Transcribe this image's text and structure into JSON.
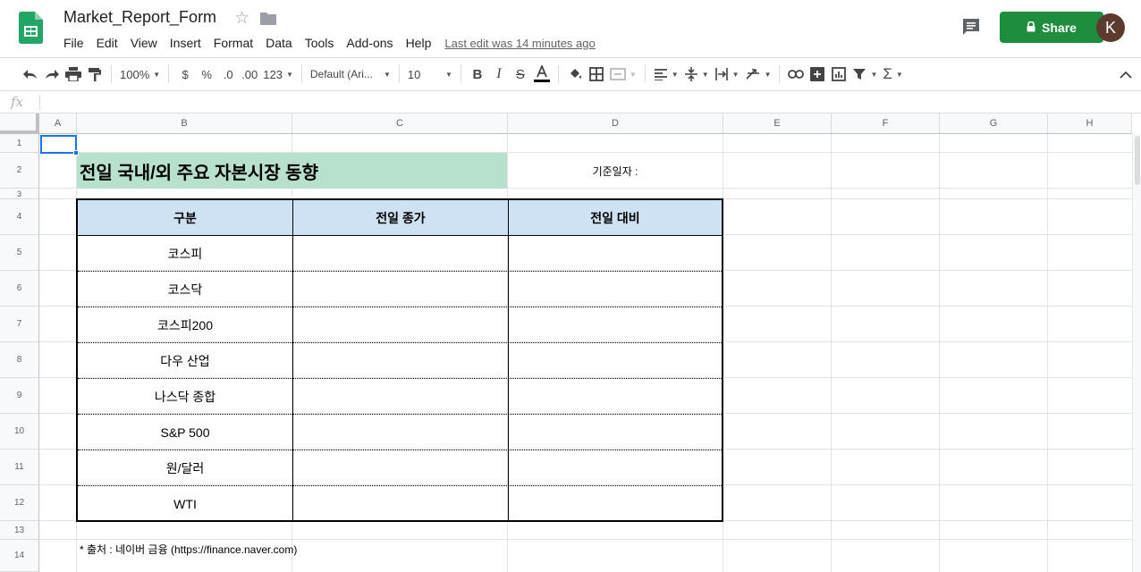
{
  "app": {
    "doc_title": "Market_Report_Form",
    "last_edit": "Last edit was 14 minutes ago",
    "share_label": "Share",
    "avatar_letter": "K"
  },
  "menu": [
    "File",
    "Edit",
    "View",
    "Insert",
    "Format",
    "Data",
    "Tools",
    "Add-ons",
    "Help"
  ],
  "toolbar": {
    "zoom": "100%",
    "currency": "$",
    "percent": "%",
    "decrease_decimal": ".0",
    "increase_decimal": ".00",
    "more_formats": "123",
    "font": "Default (Ari...",
    "font_size": "10"
  },
  "formula_bar": {
    "fx": "fx",
    "value": ""
  },
  "columns": [
    "A",
    "B",
    "C",
    "D",
    "E",
    "F",
    "G",
    "H"
  ],
  "rows": [
    "1",
    "2",
    "3",
    "4",
    "5",
    "6",
    "7",
    "8",
    "9",
    "10",
    "11",
    "12",
    "13",
    "14"
  ],
  "sheet": {
    "title": "전일 국내/외 주요 자본시장 동향",
    "date_label": "기준일자 :",
    "table_headers": [
      "구분",
      "전일 종가",
      "전일 대비"
    ],
    "table_rows": [
      "코스피",
      "코스닥",
      "코스피200",
      "다우 산업",
      "나스닥 종합",
      "S&P 500",
      "원/달러",
      "WTI"
    ],
    "source_note": "* 출처 : 네이버 금융 (https://finance.naver.com)"
  },
  "colors": {
    "title_fill": "#b7e1cd",
    "header_fill": "#cfe2f3",
    "share_button": "#1e8e3e",
    "selection": "#1a73e8"
  }
}
